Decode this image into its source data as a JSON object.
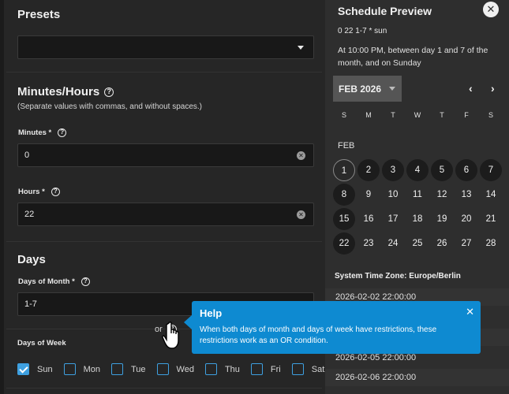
{
  "form": {
    "presets_title": "Presets",
    "presets_value": "",
    "minutes_hours_title": "Minutes/Hours",
    "minutes_hours_hint": "(Separate values with commas, and without spaces.)",
    "minutes_label": "Minutes *",
    "minutes_value": "0",
    "hours_label": "Hours *",
    "hours_value": "22",
    "days_title": "Days",
    "dom_label": "Days of Month *",
    "dom_value": "1-7",
    "or_text": "or",
    "dow_label": "Days of Week",
    "weekdays": [
      {
        "label": "Sun",
        "checked": true
      },
      {
        "label": "Mon",
        "checked": false
      },
      {
        "label": "Tue",
        "checked": false
      },
      {
        "label": "Wed",
        "checked": false
      },
      {
        "label": "Thu",
        "checked": false
      },
      {
        "label": "Fri",
        "checked": false
      },
      {
        "label": "Sat",
        "checked": false
      }
    ]
  },
  "preview": {
    "title": "Schedule Preview",
    "close_glyph": "✕",
    "cron": "0 22 1-7 * sun",
    "description": "At 10:00 PM, between day 1 and 7 of the month, and on Sunday",
    "month_button": "FEB 2026",
    "prev_glyph": "‹",
    "next_glyph": "›",
    "weekday_headers": [
      "S",
      "M",
      "T",
      "W",
      "T",
      "F",
      "S"
    ],
    "calendar_month_label": "FEB",
    "weeks": [
      [
        "1",
        "2",
        "3",
        "4",
        "5",
        "6",
        "7"
      ],
      [
        "8",
        "9",
        "10",
        "11",
        "12",
        "13",
        "14"
      ],
      [
        "15",
        "16",
        "17",
        "18",
        "19",
        "20",
        "21"
      ],
      [
        "22",
        "23",
        "24",
        "25",
        "26",
        "27",
        "28"
      ]
    ],
    "selected_days": [
      "1",
      "2",
      "3",
      "4",
      "5",
      "6",
      "7",
      "8",
      "15",
      "22"
    ],
    "today": "1",
    "timezone": "System Time Zone: Europe/Berlin",
    "timestamps": [
      "2026-02-02 22:00:00",
      "",
      "",
      "2026-02-05 22:00:00",
      "2026-02-06 22:00:00"
    ]
  },
  "help": {
    "title": "Help",
    "close_glyph": "✕",
    "text": "When both days of month and days of week have restrictions, these restrictions work as an OR condition."
  },
  "colors": {
    "accent": "#0e8ad1",
    "checkbox": "#3ea0e0"
  },
  "icons": {
    "help": "help-circle-icon",
    "clear": "clear-icon",
    "dropdown": "chevron-down-icon",
    "cursor": "hand-pointer-icon"
  }
}
